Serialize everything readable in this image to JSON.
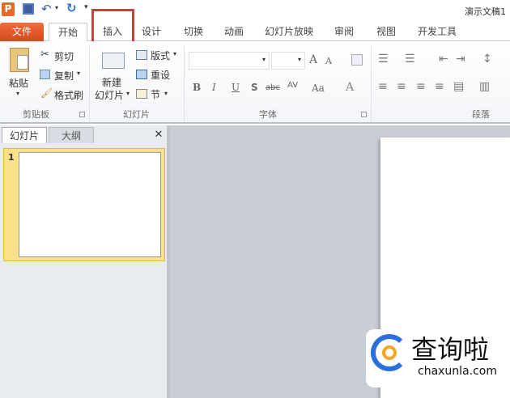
{
  "title": "演示文稿1",
  "quick_access": {
    "app_icon": "P",
    "save": "save-icon",
    "undo": "undo-icon",
    "redo": "redo-icon"
  },
  "tabs": [
    "文件",
    "开始",
    "插入",
    "设计",
    "切换",
    "动画",
    "幻灯片放映",
    "审阅",
    "视图",
    "开发工具"
  ],
  "active_tab": "开始",
  "highlight_color": "#d9383f",
  "clipboard": {
    "paste": "粘贴",
    "cut": "剪切",
    "copy": "复制",
    "format_painter": "格式刷",
    "label": "剪贴板"
  },
  "slides_group": {
    "new_slide_line1": "新建",
    "new_slide_line2": "幻灯片",
    "layout": "版式",
    "reset": "重设",
    "section": "节",
    "label": "幻灯片"
  },
  "font_group": {
    "label": "字体",
    "bold": "B",
    "italic": "I",
    "underline": "U",
    "shadow": "S",
    "strike": "abc",
    "spacing": "AV",
    "case": "Aa",
    "color": "A",
    "grow": "A",
    "shrink": "A"
  },
  "paragraph_group": {
    "label": "段落"
  },
  "pane": {
    "tab_slides": "幻灯片",
    "tab_outline": "大纲",
    "close": "✕",
    "slide_number": "1"
  },
  "watermark": {
    "brand": "查询啦",
    "url": "chaxunla.com"
  }
}
